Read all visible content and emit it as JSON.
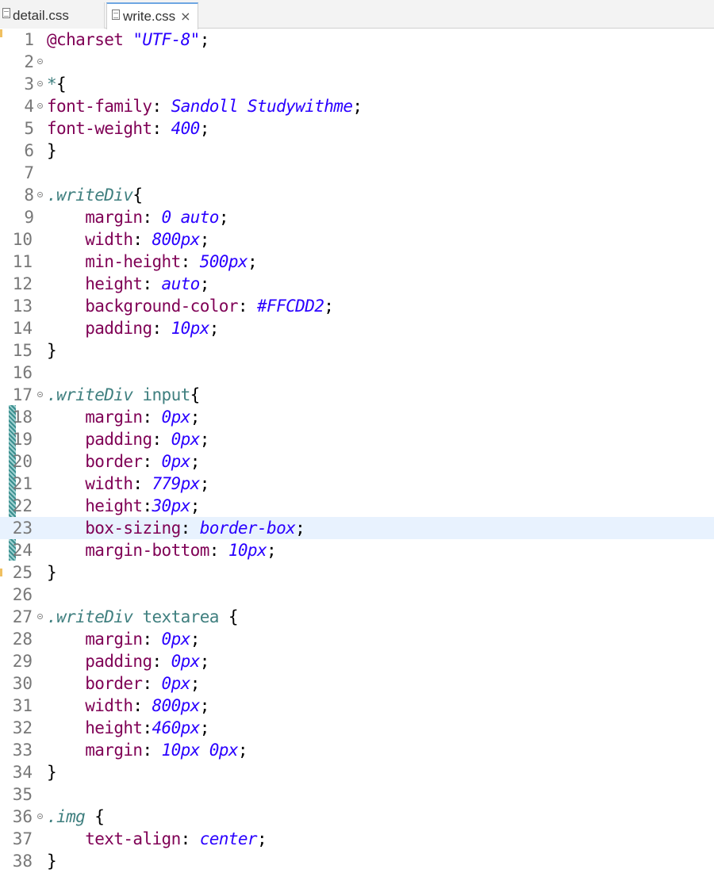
{
  "tabs": [
    {
      "label": "detail.css",
      "active": false
    },
    {
      "label": "write.css",
      "active": true,
      "close": "×"
    }
  ],
  "lines": [
    {
      "n": "1",
      "fold": false,
      "tokens": [
        [
          "k",
          "@charset "
        ],
        [
          "s",
          "\"UTF-8\""
        ],
        [
          "b",
          ";"
        ]
      ]
    },
    {
      "n": "2",
      "fold": true,
      "tokens": []
    },
    {
      "n": "3",
      "fold": true,
      "tokens": [
        [
          "tag",
          "*"
        ],
        [
          "b",
          "{"
        ]
      ]
    },
    {
      "n": "4",
      "fold": true,
      "tokens": [
        [
          "p",
          "font-family"
        ],
        [
          "b",
          ": "
        ],
        [
          "v",
          "Sandoll Studywithme"
        ],
        [
          "b",
          ";"
        ]
      ]
    },
    {
      "n": "5",
      "fold": false,
      "tokens": [
        [
          "p",
          "font-weight"
        ],
        [
          "b",
          ": "
        ],
        [
          "v",
          "400"
        ],
        [
          "b",
          ";"
        ]
      ]
    },
    {
      "n": "6",
      "fold": false,
      "tokens": [
        [
          "b",
          "}"
        ]
      ]
    },
    {
      "n": "7",
      "fold": false,
      "tokens": []
    },
    {
      "n": "8",
      "fold": true,
      "tokens": [
        [
          "sel",
          ".writeDiv"
        ],
        [
          "b",
          "{"
        ]
      ]
    },
    {
      "n": "9",
      "fold": false,
      "tokens": [
        [
          "b",
          "    "
        ],
        [
          "p",
          "margin"
        ],
        [
          "b",
          ": "
        ],
        [
          "v",
          "0 auto"
        ],
        [
          "b",
          ";"
        ]
      ]
    },
    {
      "n": "10",
      "fold": false,
      "tokens": [
        [
          "b",
          "    "
        ],
        [
          "p",
          "width"
        ],
        [
          "b",
          ": "
        ],
        [
          "v",
          "800px"
        ],
        [
          "b",
          ";"
        ]
      ]
    },
    {
      "n": "11",
      "fold": false,
      "tokens": [
        [
          "b",
          "    "
        ],
        [
          "p",
          "min-height"
        ],
        [
          "b",
          ": "
        ],
        [
          "v",
          "500px"
        ],
        [
          "b",
          ";"
        ]
      ]
    },
    {
      "n": "12",
      "fold": false,
      "tokens": [
        [
          "b",
          "    "
        ],
        [
          "p",
          "height"
        ],
        [
          "b",
          ": "
        ],
        [
          "v",
          "auto"
        ],
        [
          "b",
          ";"
        ]
      ]
    },
    {
      "n": "13",
      "fold": false,
      "tokens": [
        [
          "b",
          "    "
        ],
        [
          "p",
          "background-color"
        ],
        [
          "b",
          ": "
        ],
        [
          "v",
          "#FFCDD2"
        ],
        [
          "b",
          ";"
        ]
      ]
    },
    {
      "n": "14",
      "fold": false,
      "tokens": [
        [
          "b",
          "    "
        ],
        [
          "p",
          "padding"
        ],
        [
          "b",
          ": "
        ],
        [
          "v",
          "10px"
        ],
        [
          "b",
          ";"
        ]
      ]
    },
    {
      "n": "15",
      "fold": false,
      "tokens": [
        [
          "b",
          "}"
        ]
      ]
    },
    {
      "n": "16",
      "fold": false,
      "tokens": []
    },
    {
      "n": "17",
      "fold": true,
      "tokens": [
        [
          "sel",
          ".writeDiv"
        ],
        [
          "b",
          " "
        ],
        [
          "tag",
          "input"
        ],
        [
          "b",
          "{"
        ]
      ]
    },
    {
      "n": "18",
      "fold": false,
      "tokens": [
        [
          "b",
          "    "
        ],
        [
          "p",
          "margin"
        ],
        [
          "b",
          ": "
        ],
        [
          "v",
          "0px"
        ],
        [
          "b",
          ";"
        ]
      ]
    },
    {
      "n": "19",
      "fold": false,
      "tokens": [
        [
          "b",
          "    "
        ],
        [
          "p",
          "padding"
        ],
        [
          "b",
          ": "
        ],
        [
          "v",
          "0px"
        ],
        [
          "b",
          ";"
        ]
      ]
    },
    {
      "n": "20",
      "fold": false,
      "tokens": [
        [
          "b",
          "    "
        ],
        [
          "p",
          "border"
        ],
        [
          "b",
          ": "
        ],
        [
          "v",
          "0px"
        ],
        [
          "b",
          ";"
        ]
      ]
    },
    {
      "n": "21",
      "fold": false,
      "tokens": [
        [
          "b",
          "    "
        ],
        [
          "p",
          "width"
        ],
        [
          "b",
          ": "
        ],
        [
          "v",
          "779px"
        ],
        [
          "b",
          ";"
        ]
      ]
    },
    {
      "n": "22",
      "fold": false,
      "tokens": [
        [
          "b",
          "    "
        ],
        [
          "p",
          "height"
        ],
        [
          "b",
          ":"
        ],
        [
          "v",
          "30px"
        ],
        [
          "b",
          ";"
        ]
      ]
    },
    {
      "n": "23",
      "fold": false,
      "current": true,
      "tokens": [
        [
          "b",
          "    "
        ],
        [
          "p",
          "box-sizing"
        ],
        [
          "b",
          ": "
        ],
        [
          "v",
          "border-box"
        ],
        [
          "b",
          ";"
        ]
      ]
    },
    {
      "n": "24",
      "fold": false,
      "tokens": [
        [
          "b",
          "    "
        ],
        [
          "p",
          "margin-bottom"
        ],
        [
          "b",
          ": "
        ],
        [
          "v",
          "10px"
        ],
        [
          "b",
          ";"
        ]
      ]
    },
    {
      "n": "25",
      "fold": false,
      "tokens": [
        [
          "b",
          "}"
        ]
      ]
    },
    {
      "n": "26",
      "fold": false,
      "tokens": []
    },
    {
      "n": "27",
      "fold": true,
      "tokens": [
        [
          "sel",
          ".writeDiv"
        ],
        [
          "b",
          " "
        ],
        [
          "tag",
          "textarea"
        ],
        [
          "b",
          " {"
        ]
      ]
    },
    {
      "n": "28",
      "fold": false,
      "tokens": [
        [
          "b",
          "    "
        ],
        [
          "p",
          "margin"
        ],
        [
          "b",
          ": "
        ],
        [
          "v",
          "0px"
        ],
        [
          "b",
          ";"
        ]
      ]
    },
    {
      "n": "29",
      "fold": false,
      "tokens": [
        [
          "b",
          "    "
        ],
        [
          "p",
          "padding"
        ],
        [
          "b",
          ": "
        ],
        [
          "v",
          "0px"
        ],
        [
          "b",
          ";"
        ]
      ]
    },
    {
      "n": "30",
      "fold": false,
      "tokens": [
        [
          "b",
          "    "
        ],
        [
          "p",
          "border"
        ],
        [
          "b",
          ": "
        ],
        [
          "v",
          "0px"
        ],
        [
          "b",
          ";"
        ]
      ]
    },
    {
      "n": "31",
      "fold": false,
      "tokens": [
        [
          "b",
          "    "
        ],
        [
          "p",
          "width"
        ],
        [
          "b",
          ": "
        ],
        [
          "v",
          "800px"
        ],
        [
          "b",
          ";"
        ]
      ]
    },
    {
      "n": "32",
      "fold": false,
      "tokens": [
        [
          "b",
          "    "
        ],
        [
          "p",
          "height"
        ],
        [
          "b",
          ":"
        ],
        [
          "v",
          "460px"
        ],
        [
          "b",
          ";"
        ]
      ]
    },
    {
      "n": "33",
      "fold": false,
      "tokens": [
        [
          "b",
          "    "
        ],
        [
          "p",
          "margin"
        ],
        [
          "b",
          ": "
        ],
        [
          "v",
          "10px 0px"
        ],
        [
          "b",
          ";"
        ]
      ]
    },
    {
      "n": "34",
      "fold": false,
      "tokens": [
        [
          "b",
          "}"
        ]
      ]
    },
    {
      "n": "35",
      "fold": false,
      "tokens": []
    },
    {
      "n": "36",
      "fold": true,
      "tokens": [
        [
          "sel",
          ".img"
        ],
        [
          "b",
          " {"
        ]
      ]
    },
    {
      "n": "37",
      "fold": false,
      "tokens": [
        [
          "b",
          "    "
        ],
        [
          "p",
          "text-align"
        ],
        [
          "b",
          ": "
        ],
        [
          "v",
          "center"
        ],
        [
          "b",
          ";"
        ]
      ]
    },
    {
      "n": "38",
      "fold": false,
      "tokens": [
        [
          "b",
          "}"
        ]
      ]
    }
  ]
}
